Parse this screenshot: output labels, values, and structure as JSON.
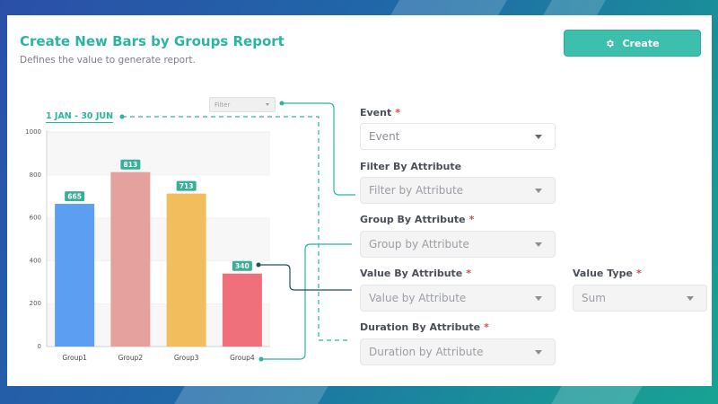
{
  "header": {
    "title": "Create New Bars by Groups Report",
    "subtitle": "Defines the value to generate report.",
    "create_label": "Create"
  },
  "filter": {
    "placeholder": "Filter"
  },
  "date_range": "1 JAN - 30 JUN",
  "chart_data": {
    "type": "bar",
    "categories": [
      "Group1",
      "Group2",
      "Group3",
      "Group4"
    ],
    "values": [
      665,
      813,
      713,
      340
    ],
    "colors": [
      "#5b9ef2",
      "#e4a19e",
      "#f2bd5c",
      "#ef6f7b"
    ],
    "ylim": [
      0,
      1000
    ],
    "yticks": [
      0,
      200,
      400,
      600,
      800,
      1000
    ],
    "grid": true
  },
  "form": {
    "event": {
      "label": "Event",
      "required": "*",
      "value": "Event"
    },
    "filter_by": {
      "label": "Filter By Attribute",
      "value": "Filter by Attribute"
    },
    "group_by": {
      "label": "Group By Attribute",
      "required": "*",
      "value": "Group by Attribute"
    },
    "value_by": {
      "label": "Value By Attribute",
      "required": "*",
      "value": "Value by Attribute"
    },
    "value_type": {
      "label": "Value Type",
      "required": "*",
      "value": "Sum"
    },
    "duration_by": {
      "label": "Duration By Attribute",
      "required": "*",
      "value": "Duration by Attribute"
    }
  },
  "colors": {
    "accent": "#2bb5a0",
    "button": "#3dbfae",
    "required": "#e0483e",
    "connector_dark": "#1f4f5a"
  }
}
